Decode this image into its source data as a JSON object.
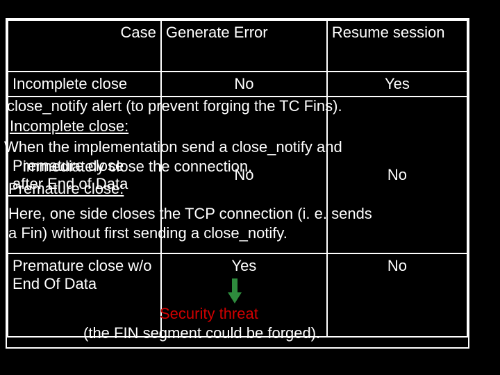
{
  "table": {
    "header": {
      "case": "Case",
      "gen": "Generate Error",
      "resume": "Resume session"
    },
    "rows": [
      {
        "case": "Incomplete close",
        "gen": "No",
        "resume": "Yes"
      },
      {
        "case": "Premature close after End of Data",
        "gen": "No",
        "resume": "No"
      },
      {
        "case": "Premature close w/o End Of Data",
        "gen": "Yes",
        "resume": "No"
      }
    ]
  },
  "overlay": {
    "line1": "close_notify alert (to prevent forging the TC Fins).",
    "incomplete": "Incomplete close:",
    "impl1": "When the implementation send a close_notify and",
    "impl2": "immediately close the connection.",
    "premature": "Premature close:",
    "here1": "Here, one side closes the TCP connection (i. e. sends",
    "here2": " a Fin) without first sending a close_notify.",
    "threat": "Security threat",
    "forged": "(the FIN segment could be forged)."
  }
}
